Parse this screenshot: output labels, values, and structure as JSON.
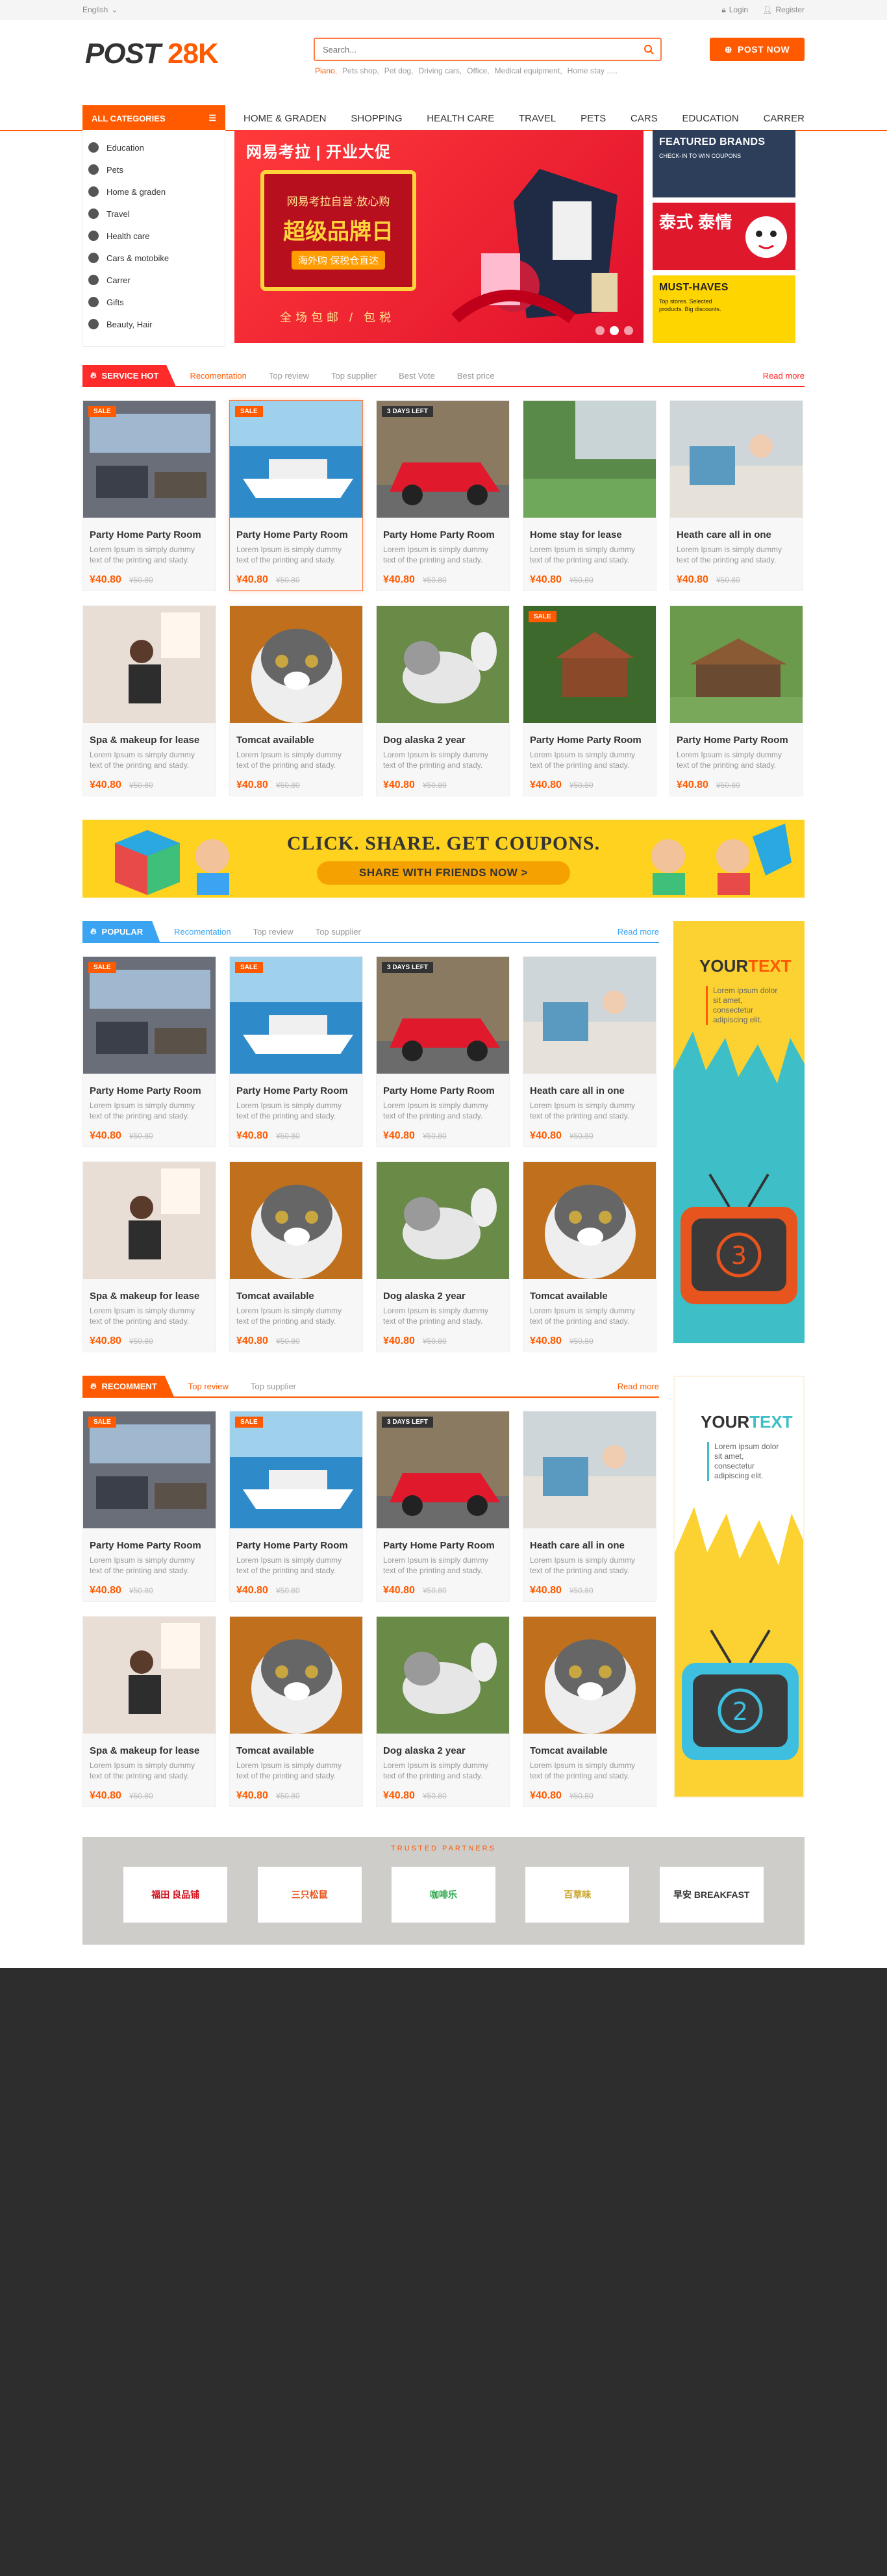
{
  "topbar": {
    "language": "English",
    "login": "Login",
    "register": "Register"
  },
  "header": {
    "logo_prefix": "POST",
    "logo_suffix": "28K",
    "search_placeholder": "Search...",
    "hot_keywords": [
      "Piano",
      "Pets shop",
      "Pet dog",
      "Driving cars",
      "Office",
      "Medical equipment",
      "Home stay ....."
    ],
    "post_now": "POST NOW"
  },
  "nav": {
    "all_categories": "ALL CATEGORIES",
    "menu": [
      "HOME & GRADEN",
      "SHOPPING",
      "HEALTH CARE",
      "TRAVEL",
      "PETS",
      "CARS",
      "EDUCATION",
      "CARRER"
    ]
  },
  "categories": [
    {
      "label": "Education",
      "icon": "education-icon"
    },
    {
      "label": "Pets",
      "icon": "paw-icon"
    },
    {
      "label": "Home & graden",
      "icon": "home-icon"
    },
    {
      "label": "Travel",
      "icon": "suitcase-icon"
    },
    {
      "label": "Health care",
      "icon": "heart-icon"
    },
    {
      "label": "Cars & motobike",
      "icon": "steering-icon"
    },
    {
      "label": "Carrer",
      "icon": "user-icon"
    },
    {
      "label": "Gifts",
      "icon": "gift-icon"
    },
    {
      "label": "Beauty, Hair",
      "icon": "beauty-icon"
    }
  ],
  "hero": {
    "brand": "网易考拉 | 开业大促",
    "line1": "网易考拉自营·放心购",
    "line2": "超级品牌日",
    "line3": "海外购 保税仓直达",
    "sub": "全场包邮 / 包税"
  },
  "side_banners": [
    {
      "title": "FEATURED BRANDS",
      "text": "CHECK-IN TO WIN COUPONS"
    },
    {
      "title": "泰式 泰情",
      "text": ""
    },
    {
      "title": "MUST-HAVES",
      "text": "Top stores. Selected products. Big discounts."
    }
  ],
  "sections": {
    "service_hot": {
      "label": "SERVICE HOT",
      "tabs": [
        "Recomentation",
        "Top review",
        "Top supplier",
        "Best Vote",
        "Best price"
      ],
      "more": "Read more"
    },
    "popular": {
      "label": "POPULAR",
      "tabs": [
        "Recomentation",
        "Top review",
        "Top supplier"
      ],
      "more": "Read more"
    },
    "recomment": {
      "label": "RECOMMENT",
      "tabs": [
        "Top review",
        "Top supplier"
      ],
      "more": "Read more"
    }
  },
  "products_hot": [
    {
      "title": "Party Home Party Room",
      "badge": "SALE",
      "img": "room"
    },
    {
      "title": "Party Home Party Room",
      "badge": "SALE",
      "img": "yacht"
    },
    {
      "title": "Party Home Party Room",
      "badge": "3 DAYS LEFT",
      "img": "car"
    },
    {
      "title": "Home stay for lease",
      "badge": "",
      "img": "garden"
    },
    {
      "title": "Heath care all in one",
      "badge": "",
      "img": "clinic"
    },
    {
      "title": "Spa & makeup for lease",
      "badge": "",
      "img": "spa"
    },
    {
      "title": "Tomcat available",
      "badge": "",
      "img": "cat"
    },
    {
      "title": "Dog alaska 2 year",
      "badge": "",
      "img": "dog"
    },
    {
      "title": "Party Home Party Room",
      "badge": "SALE",
      "img": "forest"
    },
    {
      "title": "Party Home Party Room",
      "badge": "",
      "img": "cabin"
    }
  ],
  "products_popular": [
    {
      "title": "Party Home Party Room",
      "badge": "SALE",
      "img": "room"
    },
    {
      "title": "Party Home Party Room",
      "badge": "SALE",
      "img": "yacht"
    },
    {
      "title": "Party Home Party Room",
      "badge": "3 DAYS LEFT",
      "img": "car"
    },
    {
      "title": "Heath care all in one",
      "badge": "",
      "img": "clinic"
    },
    {
      "title": "Spa & makeup for lease",
      "badge": "",
      "img": "spa"
    },
    {
      "title": "Tomcat available",
      "badge": "",
      "img": "cat"
    },
    {
      "title": "Dog alaska 2 year",
      "badge": "",
      "img": "dog"
    },
    {
      "title": "Tomcat available",
      "badge": "",
      "img": "cat"
    }
  ],
  "products_recomment": [
    {
      "title": "Party Home Party Room",
      "badge": "SALE",
      "img": "room"
    },
    {
      "title": "Party Home Party Room",
      "badge": "SALE",
      "img": "yacht"
    },
    {
      "title": "Party Home Party Room",
      "badge": "3 DAYS LEFT",
      "img": "car"
    },
    {
      "title": "Heath care all in one",
      "badge": "",
      "img": "clinic"
    },
    {
      "title": "Spa & makeup for lease",
      "badge": "",
      "img": "spa"
    },
    {
      "title": "Tomcat available",
      "badge": "",
      "img": "cat"
    },
    {
      "title": "Dog alaska 2 year",
      "badge": "",
      "img": "dog"
    },
    {
      "title": "Tomcat available",
      "badge": "",
      "img": "cat"
    }
  ],
  "product_desc": "Lorem Ipsum is simply dummy text of the printing and  stady.",
  "price": "¥40.80",
  "old_price": "¥50.80",
  "coupon": {
    "title": "CLICK. SHARE. GET COUPONS.",
    "button": "SHARE WITH FRIENDS NOW >"
  },
  "ad1": {
    "title_a": "YOUR",
    "title_b": "TEXT",
    "text": "Lorem ipsum dolor sit amet, consectetur adipiscing elit.",
    "number": "3"
  },
  "ad2": {
    "title_a": "YOUR",
    "title_b": "TEXT",
    "text": "Lorem ipsum dolor sit amet, consectetur adipiscing elit.",
    "number": "2"
  },
  "partners": {
    "title": "TRUSTED PARTNERS",
    "logos": [
      "福田 良品铺",
      "三只松鼠",
      "咖啡乐",
      "百草味",
      "早安 BREAKFAST"
    ]
  },
  "colors": {
    "accent": "#ff5a00",
    "red": "#ff2a2a",
    "blue": "#3aa3f2",
    "footer": "#2d2d2d"
  }
}
